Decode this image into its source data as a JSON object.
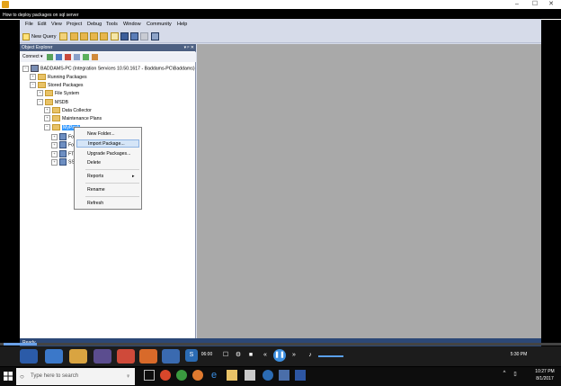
{
  "player": {
    "title": "How to deploy packages on sql server",
    "time_left": "06:00",
    "time_right": "5:30 PM"
  },
  "menu": [
    "File",
    "Edit",
    "View",
    "Project",
    "Debug",
    "Tools",
    "Window",
    "Community",
    "Help"
  ],
  "toolbar": {
    "new_query": "New Query"
  },
  "object_explorer": {
    "header": "Object Explorer",
    "connect": "Connect",
    "header_pin": "▾ ᵖ ✕"
  },
  "tree": {
    "server": "BADDAMS-PC (Integration Services 10.50.1617 - Baddams-PC\\Baddams)",
    "running": "Running Packages",
    "stored": "Stored Packages",
    "filesystem": "File System",
    "msdb": "MSDB",
    "datacollector": "Data Collector",
    "maintenance": "Maintenance Plans",
    "mypack": "MyPack",
    "child1": "For",
    "child2": "For",
    "child3": "FTP",
    "child4": "SSIS"
  },
  "context_menu": {
    "new_folder": "New Folder...",
    "import": "Import Package...",
    "upgrade": "Upgrade Packages...",
    "delete": "Delete",
    "reports": "Reports",
    "rename": "Rename",
    "refresh": "Refresh"
  },
  "status": {
    "ready": "Ready"
  },
  "taskbar": {
    "search_placeholder": "Type here to search",
    "clock_time": "10:27 PM",
    "clock_date": "8/1/2017"
  },
  "colors": {
    "accent": "#3399ff",
    "oe_header": "#4d6082",
    "menu_bg": "#d6dbe9",
    "status_bar": "#2c4876"
  },
  "progress": {
    "fraction": 0.06
  }
}
